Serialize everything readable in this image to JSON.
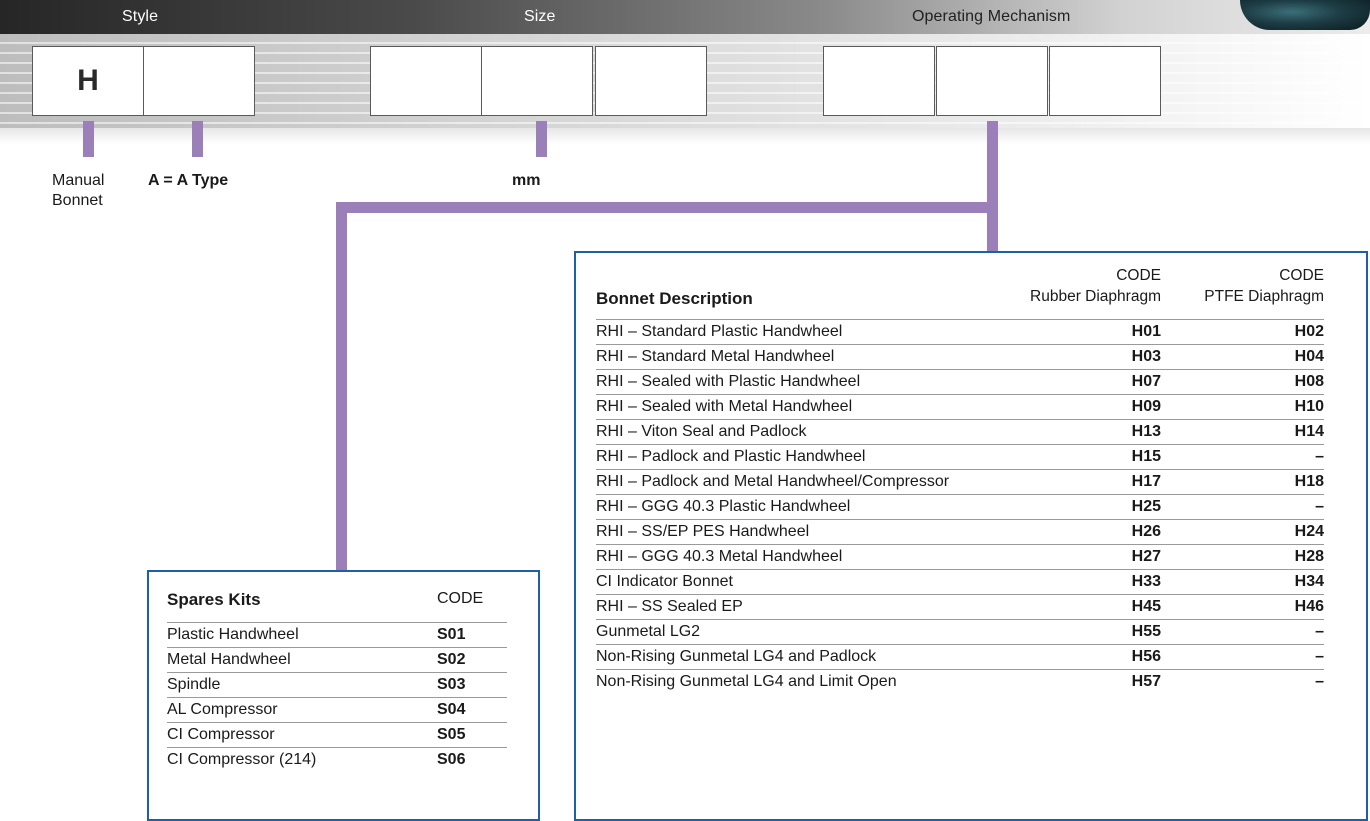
{
  "header": {
    "style_label": "Style",
    "size_label": "Size",
    "mechanism_label": "Operating Mechanism"
  },
  "code_boxes": {
    "style_first": "H",
    "style_second": "",
    "size_1": "",
    "size_2": "",
    "size_3": "",
    "mech_1": "",
    "mech_2": "",
    "mech_3": ""
  },
  "captions": {
    "manual_bonnet_1": "Manual",
    "manual_bonnet_2": "Bonnet",
    "a_type": "A = A Type",
    "mm": "mm"
  },
  "bonnet": {
    "title": "Bonnet Description",
    "col1_code": "CODE",
    "col1_sub": "Rubber Diaphragm",
    "col2_code": "CODE",
    "col2_sub": "PTFE Diaphragm",
    "rows": [
      {
        "desc": "RHI – Standard Plastic Handwheel",
        "rubber": "H01",
        "ptfe": "H02"
      },
      {
        "desc": "RHI – Standard Metal Handwheel",
        "rubber": "H03",
        "ptfe": "H04"
      },
      {
        "desc": "RHI – Sealed with Plastic Handwheel",
        "rubber": "H07",
        "ptfe": "H08"
      },
      {
        "desc": "RHI – Sealed with Metal Handwheel",
        "rubber": "H09",
        "ptfe": "H10"
      },
      {
        "desc": "RHI – Viton Seal and Padlock",
        "rubber": "H13",
        "ptfe": "H14"
      },
      {
        "desc": "RHI – Padlock and Plastic Handwheel",
        "rubber": "H15",
        "ptfe": "–"
      },
      {
        "desc": "RHI – Padlock and Metal Handwheel/Compressor",
        "rubber": "H17",
        "ptfe": "H18"
      },
      {
        "desc": "RHI – GGG 40.3 Plastic Handwheel",
        "rubber": "H25",
        "ptfe": "–"
      },
      {
        "desc": "RHI – SS/EP PES Handwheel",
        "rubber": "H26",
        "ptfe": "H24"
      },
      {
        "desc": "RHI – GGG 40.3 Metal Handwheel",
        "rubber": "H27",
        "ptfe": "H28"
      },
      {
        "desc": "CI Indicator Bonnet",
        "rubber": "H33",
        "ptfe": "H34"
      },
      {
        "desc": "RHI – SS Sealed EP",
        "rubber": "H45",
        "ptfe": "H46"
      },
      {
        "desc": "Gunmetal LG2",
        "rubber": "H55",
        "ptfe": "–"
      },
      {
        "desc": "Non-Rising Gunmetal LG4 and Padlock",
        "rubber": "H56",
        "ptfe": "–"
      },
      {
        "desc": "Non-Rising Gunmetal LG4 and Limit Open",
        "rubber": "H57",
        "ptfe": "–"
      }
    ]
  },
  "spares": {
    "title": "Spares Kits",
    "code_label": "CODE",
    "rows": [
      {
        "desc": "Plastic Handwheel",
        "code": "S01"
      },
      {
        "desc": "Metal Handwheel",
        "code": "S02"
      },
      {
        "desc": "Spindle",
        "code": "S03"
      },
      {
        "desc": "AL Compressor",
        "code": "S04"
      },
      {
        "desc": "CI Compressor",
        "code": "S05"
      },
      {
        "desc": "CI Compressor (214)",
        "code": "S06"
      }
    ]
  }
}
